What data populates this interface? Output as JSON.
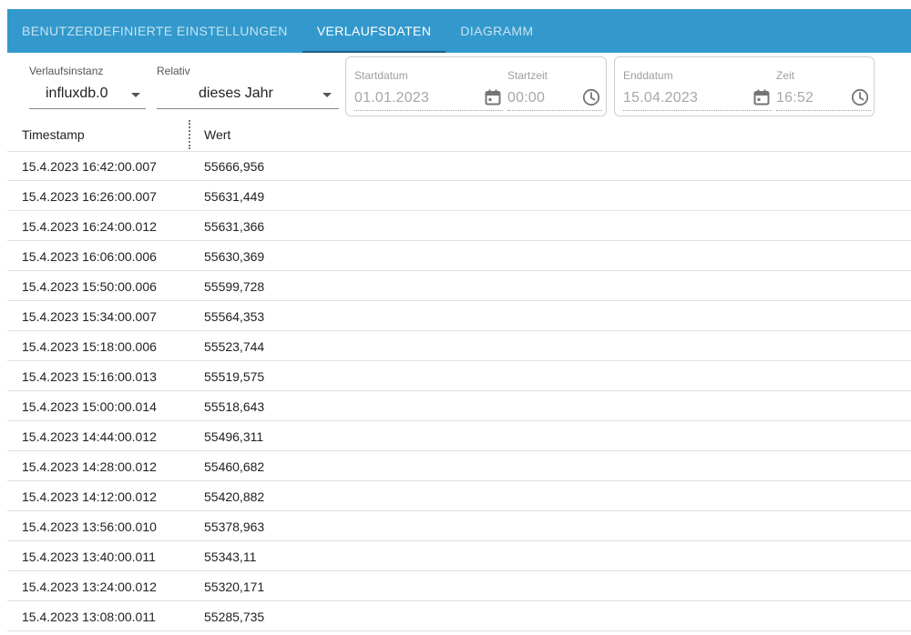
{
  "tabs": [
    {
      "label": "Benutzerdefinierte Einstellungen",
      "active": false
    },
    {
      "label": "Verlaufsdaten",
      "active": true
    },
    {
      "label": "Diagramm",
      "active": false
    }
  ],
  "filters": {
    "instance": {
      "label": "Verlaufsinstanz",
      "value": "influxdb.0"
    },
    "relative": {
      "label": "Relativ",
      "value": "dieses Jahr"
    },
    "start": {
      "date_label": "Startdatum",
      "date_value": "01.01.2023",
      "time_label": "Startzeit",
      "time_value": "00:00"
    },
    "end": {
      "date_label": "Enddatum",
      "date_value": "15.04.2023",
      "time_label": "Zeit",
      "time_value": "16:52"
    }
  },
  "table": {
    "columns": [
      "Timestamp",
      "Wert"
    ],
    "rows": [
      [
        "15.4.2023 16:42:00.007",
        "55666,956"
      ],
      [
        "15.4.2023 16:26:00.007",
        "55631,449"
      ],
      [
        "15.4.2023 16:24:00.012",
        "55631,366"
      ],
      [
        "15.4.2023 16:06:00.006",
        "55630,369"
      ],
      [
        "15.4.2023 15:50:00.006",
        "55599,728"
      ],
      [
        "15.4.2023 15:34:00.007",
        "55564,353"
      ],
      [
        "15.4.2023 15:18:00.006",
        "55523,744"
      ],
      [
        "15.4.2023 15:16:00.013",
        "55519,575"
      ],
      [
        "15.4.2023 15:00:00.014",
        "55518,643"
      ],
      [
        "15.4.2023 14:44:00.012",
        "55496,311"
      ],
      [
        "15.4.2023 14:28:00.012",
        "55460,682"
      ],
      [
        "15.4.2023 14:12:00.012",
        "55420,882"
      ],
      [
        "15.4.2023 13:56:00.010",
        "55378,963"
      ],
      [
        "15.4.2023 13:40:00.011",
        "55343,11"
      ],
      [
        "15.4.2023 13:24:00.012",
        "55320,171"
      ],
      [
        "15.4.2023 13:08:00.011",
        "55285,735"
      ]
    ]
  },
  "colors": {
    "tabbar": "#3399cc",
    "tab_indicator": "#1f5f86"
  }
}
